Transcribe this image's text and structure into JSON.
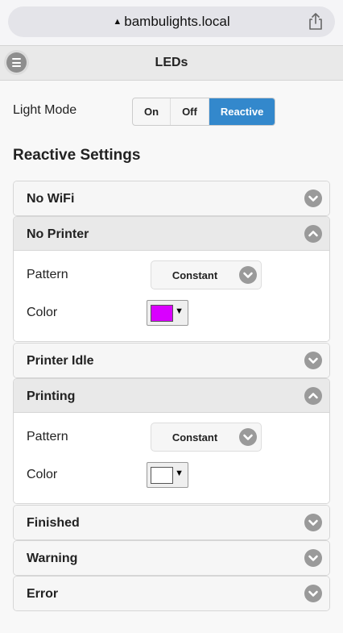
{
  "browser": {
    "url": "bambulights.local"
  },
  "header": {
    "title": "LEDs",
    "menu_icon": "hamburger-menu-icon"
  },
  "light_mode": {
    "label": "Light Mode",
    "options": [
      "On",
      "Off",
      "Reactive"
    ],
    "selected": "Reactive"
  },
  "reactive": {
    "title": "Reactive Settings",
    "sections": [
      {
        "title": "No WiFi",
        "expanded": false
      },
      {
        "title": "No Printer",
        "expanded": true,
        "pattern_label": "Pattern",
        "pattern": "Constant",
        "color_label": "Color",
        "color": "#d900ff"
      },
      {
        "title": "Printer Idle",
        "expanded": false
      },
      {
        "title": "Printing",
        "expanded": true,
        "pattern_label": "Pattern",
        "pattern": "Constant",
        "color_label": "Color",
        "color": "#ffffff"
      },
      {
        "title": "Finished",
        "expanded": false
      },
      {
        "title": "Warning",
        "expanded": false
      },
      {
        "title": "Error",
        "expanded": false
      }
    ]
  },
  "colors": {
    "accent": "#3388cc",
    "expand_button": "#9a9a9a"
  }
}
